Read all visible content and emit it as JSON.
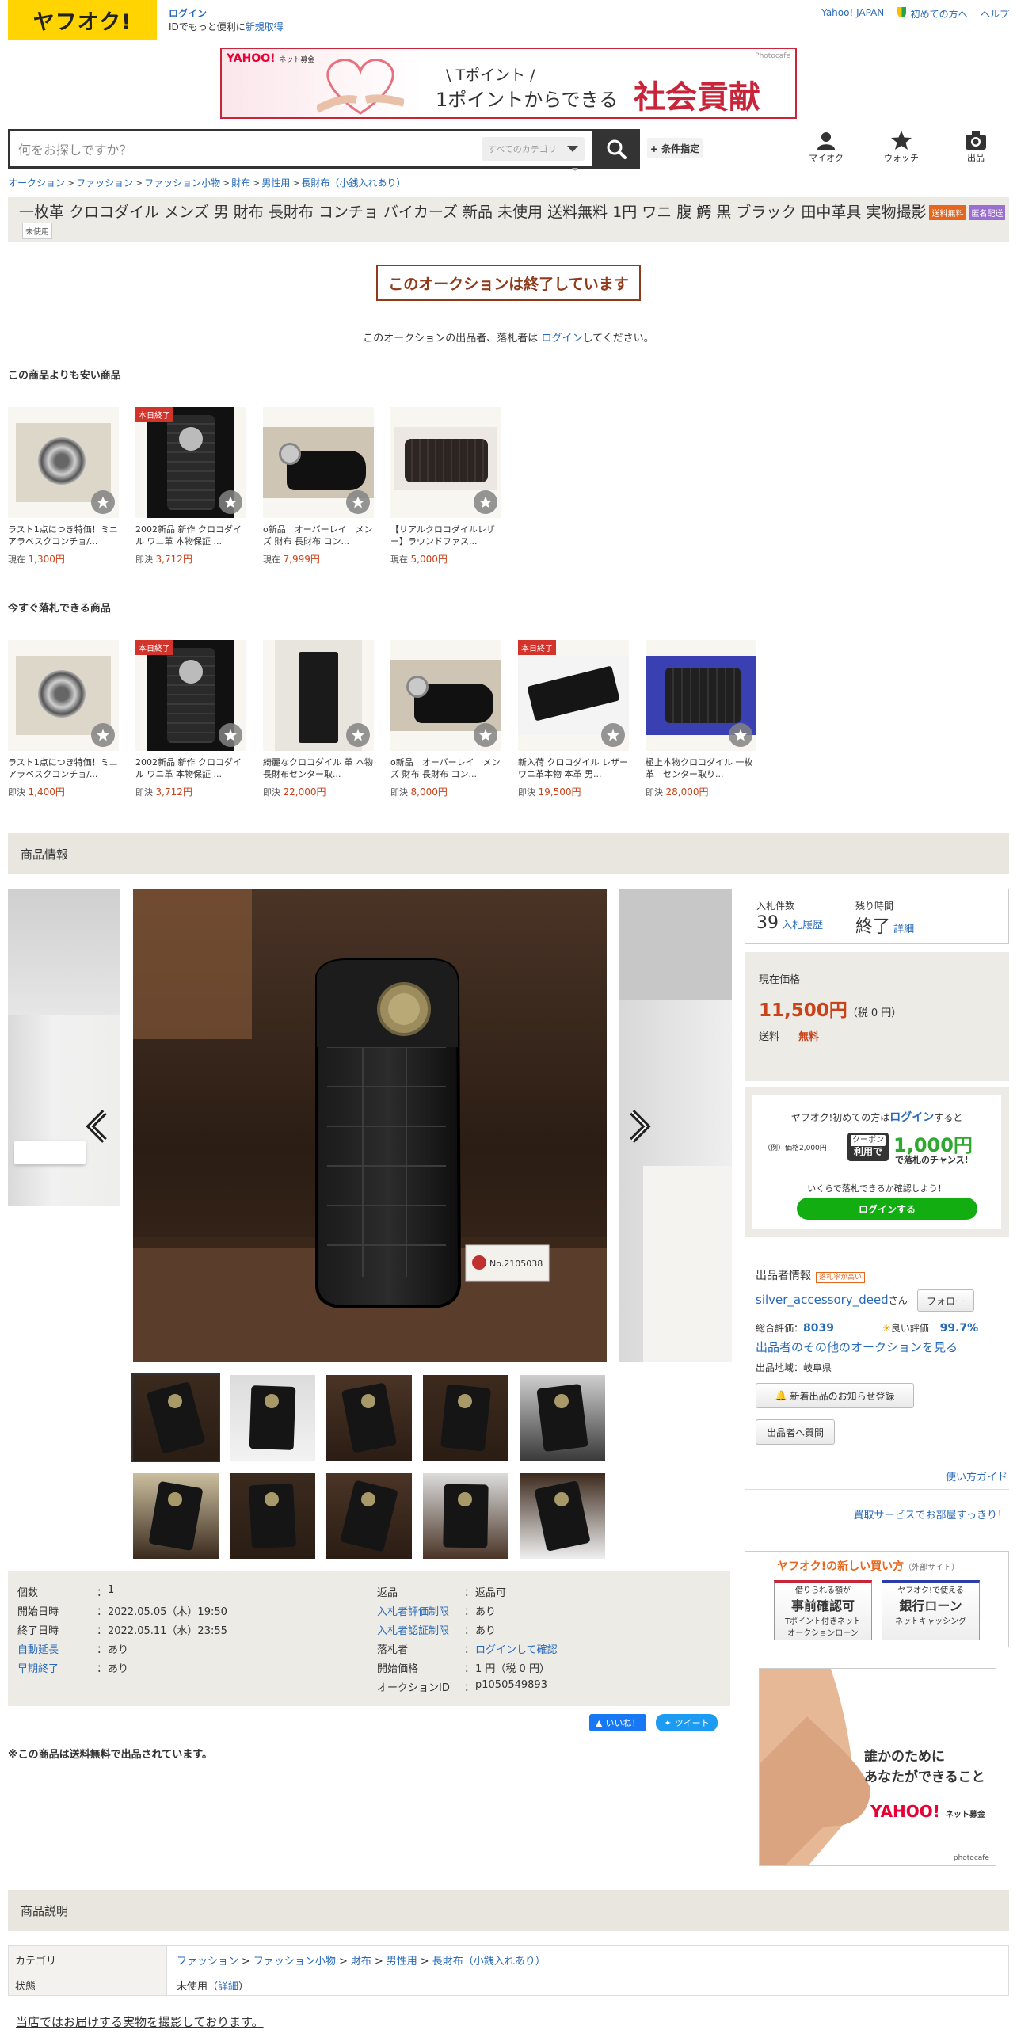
{
  "header": {
    "logo": "ヤフオク!",
    "login": "ログイン",
    "login_sub_prefix": "IDでもっと便利に",
    "login_sub_link": "新規取得",
    "links": [
      "Yahoo! JAPAN",
      "初めての方へ",
      "ヘルプ"
    ],
    "search_placeholder": "何をお探しですか？",
    "category_select": "すべてのカテゴリ",
    "condition_button": "+ 条件指定",
    "icons": [
      {
        "name": "myauction-icon",
        "label": "マイオク"
      },
      {
        "name": "watch-icon",
        "label": "ウォッチ"
      },
      {
        "name": "sell-icon",
        "label": "出品"
      }
    ]
  },
  "banner": {
    "brand": "YAHOO!",
    "brand_sub": "ネット募金",
    "credit": "Photocafe",
    "line1": "\\ Tポイント /",
    "line2": "1ポイントからできる",
    "line3": "社会貢献"
  },
  "breadcrumb": [
    "オークション",
    "ファッション",
    "ファッション小物",
    "財布",
    "男性用",
    "長財布（小銭入れあり）"
  ],
  "item": {
    "title": "一枚革 クロコダイル メンズ 男 財布 長財布 コンチョ バイカーズ 新品 未使用 送料無料 1円 ワニ 腹 鰐 黒 ブラック 田中革具 実物撮影",
    "badges": [
      "送料無料",
      "匿名配送",
      "未使用"
    ],
    "ended_label": "このオークションは終了しています",
    "ended_note_prefix": "このオークションの出品者、落札者は ",
    "ended_note_link": "ログイン",
    "ended_note_suffix": "してください。"
  },
  "cheaper": {
    "title": "この商品よりも安い商品",
    "items": [
      {
        "name": "ラスト1点につき特価！ミニアラベスクコンチョ/...",
        "price_label": "現在",
        "price": "1,300円",
        "ended": ""
      },
      {
        "name": "2002新品 新作 クロコダイル ワニ革 本物保証 ...",
        "price_label": "即決",
        "price": "3,712円",
        "ended": "本日終了"
      },
      {
        "name": "o新品　オーバーレイ　メンズ 財布 長財布 コン...",
        "price_label": "現在",
        "price": "7,999円",
        "ended": ""
      },
      {
        "name": "【リアルクロコダイルレザー】ラウンドファス...",
        "price_label": "現在",
        "price": "5,000円",
        "ended": ""
      }
    ]
  },
  "buynow": {
    "title": "今すぐ落札できる商品",
    "items": [
      {
        "name": "ラスト1点につき特価！ミニアラベスクコンチョ/...",
        "price_label": "即決",
        "price": "1,400円",
        "ended": ""
      },
      {
        "name": "2002新品 新作 クロコダイル ワニ革 本物保証 ...",
        "price_label": "即決",
        "price": "3,712円",
        "ended": "本日終了"
      },
      {
        "name": "綺麗なクロコダイル 革 本物 長財布センター取...",
        "price_label": "即決",
        "price": "22,000円",
        "ended": ""
      },
      {
        "name": "o新品　オーバーレイ　メンズ 財布 長財布 コン...",
        "price_label": "即決",
        "price": "8,000円",
        "ended": ""
      },
      {
        "name": "新入荷 クロコダイル レザー ワニ革本物 本革 男...",
        "price_label": "即決",
        "price": "19,500円",
        "ended": "本日終了"
      },
      {
        "name": "極上本物クロコダイル 一枚革　センター取り...",
        "price_label": "即決",
        "price": "28,000円",
        "ended": ""
      }
    ]
  },
  "product_info": {
    "section_title": "商品情報",
    "tag_number": "No.2105038",
    "details_left": [
      {
        "k": "個数",
        "v": "1",
        "link": false
      },
      {
        "k": "開始日時",
        "v": "2022.05.05（木）19:50",
        "link": false
      },
      {
        "k": "終了日時",
        "v": "2022.05.11（水）23:55",
        "link": false
      },
      {
        "k": "自動延長",
        "v": "あり",
        "link": true
      },
      {
        "k": "早期終了",
        "v": "あり",
        "link": true
      }
    ],
    "details_right": [
      {
        "k": "返品",
        "v": "返品可",
        "link": false
      },
      {
        "k": "入札者評価制限",
        "v": "あり",
        "link": true
      },
      {
        "k": "入札者認証制限",
        "v": "あり",
        "link": true
      },
      {
        "k": "落札者",
        "v": "ログインして確認",
        "link": false,
        "vlink": true
      },
      {
        "k": "開始価格",
        "v": "1 円（税 0 円）",
        "link": false
      },
      {
        "k": "オークションID",
        "v": "p1050549893",
        "link": false
      }
    ],
    "like_button": "いいね！",
    "tweet_button": "ツイート",
    "shipping_note": "※この商品は送料無料で出品されています。"
  },
  "bid": {
    "count_label": "入札件数",
    "count": "39",
    "history_link": "入札履歴",
    "time_label": "残り時間",
    "time_value": "終了",
    "detail_link": "詳細"
  },
  "price": {
    "label": "現在価格",
    "value": "11,500円",
    "tax": "（税 0 円）",
    "shipping_label": "送料",
    "shipping_value": "無料"
  },
  "promo": {
    "line1_prefix": "ヤフオク!初めての方は",
    "line1_link": "ログイン",
    "line1_suffix": "すると",
    "example": "（例）価格2,000円",
    "coupon_top": "クーポン",
    "coupon_bottom": "利用で",
    "amount": "1,000円",
    "amount_sub": "で落札のチャンス!",
    "line3": "いくらで落札できるか確認しよう！",
    "button": "ログインする"
  },
  "seller": {
    "title": "出品者情報",
    "badge": "落札率が高い",
    "name": "silver_accessory_deed",
    "name_suffix": "さん",
    "follow": "フォロー",
    "rating_label": "総合評価：",
    "rating": "8039",
    "good_label": "良い評価",
    "good_pct": "99.7%",
    "other_link": "出品者のその他のオークションを見る",
    "region": "出品地域：岐阜県",
    "notify_button": "新着出品のお知らせ登録",
    "question_button": "出品者へ質問",
    "guide_link": "使い方ガイド",
    "shop_link": "買取サービスでお部屋すっきり！"
  },
  "ad": {
    "title": "ヤフオク!の新しい買い方",
    "external": "（外部サイト）",
    "card1_top": "借りられる額が",
    "card1_main": "事前確認可",
    "card1_sub": "Tポイント付きネット\nオークションローン",
    "card2_top": "ヤフオク!で使える",
    "card2_main": "銀行ローン",
    "card2_sub": "ネットキャッシング",
    "ad2_line1": "誰かのために",
    "ad2_line2": "あなたができること",
    "ad2_brand": "YAHOO!",
    "ad2_brand_sub": "ネット募金",
    "ad2_credit": "photocafe"
  },
  "description": {
    "section_title": "商品説明",
    "rows": [
      {
        "k": "カテゴリ",
        "v": [
          "ファッション",
          "ファッション小物",
          "財布",
          "男性用",
          "長財布（小銭入れあり）"
        ]
      },
      {
        "k": "状態",
        "v_text": "未使用",
        "v_link": "詳細"
      }
    ],
    "footer_text": "当店ではお届けする実物を撮影しております。"
  },
  "colors": {
    "accent_red": "#c9421a",
    "link_blue": "#2769b9",
    "yahoo_yellow": "#ffd400",
    "band_bg": "#e8e6de"
  }
}
